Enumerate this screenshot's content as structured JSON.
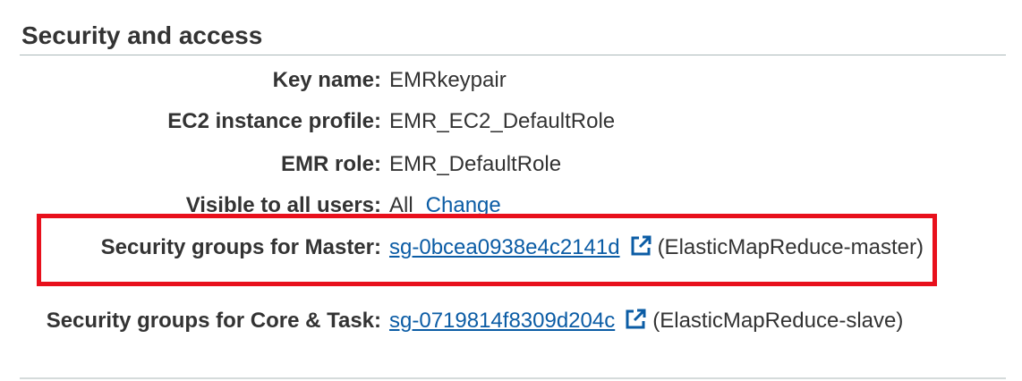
{
  "section": {
    "title": "Security and access"
  },
  "rows": {
    "key_name": {
      "label": "Key name:",
      "value": "EMRkeypair"
    },
    "ec2_profile": {
      "label": "EC2 instance profile:",
      "value": "EMR_EC2_DefaultRole"
    },
    "emr_role": {
      "label": "EMR role:",
      "value": "EMR_DefaultRole"
    },
    "visible": {
      "label": "Visible to all users:",
      "value": "All",
      "action": "Change"
    },
    "sg_master": {
      "label": "Security groups for Master:",
      "link": "sg-0bcea0938e4c2141d",
      "suffix": "(ElasticMapReduce-master)"
    },
    "sg_core": {
      "label": "Security groups for Core & Task:",
      "link": "sg-0719814f8309d204c",
      "suffix": "(ElasticMapReduce-slave)"
    }
  },
  "icons": {
    "external_link": "external-link-icon"
  },
  "colors": {
    "link": "#0b5ca5",
    "highlight": "#e8101c",
    "text": "#333333"
  }
}
